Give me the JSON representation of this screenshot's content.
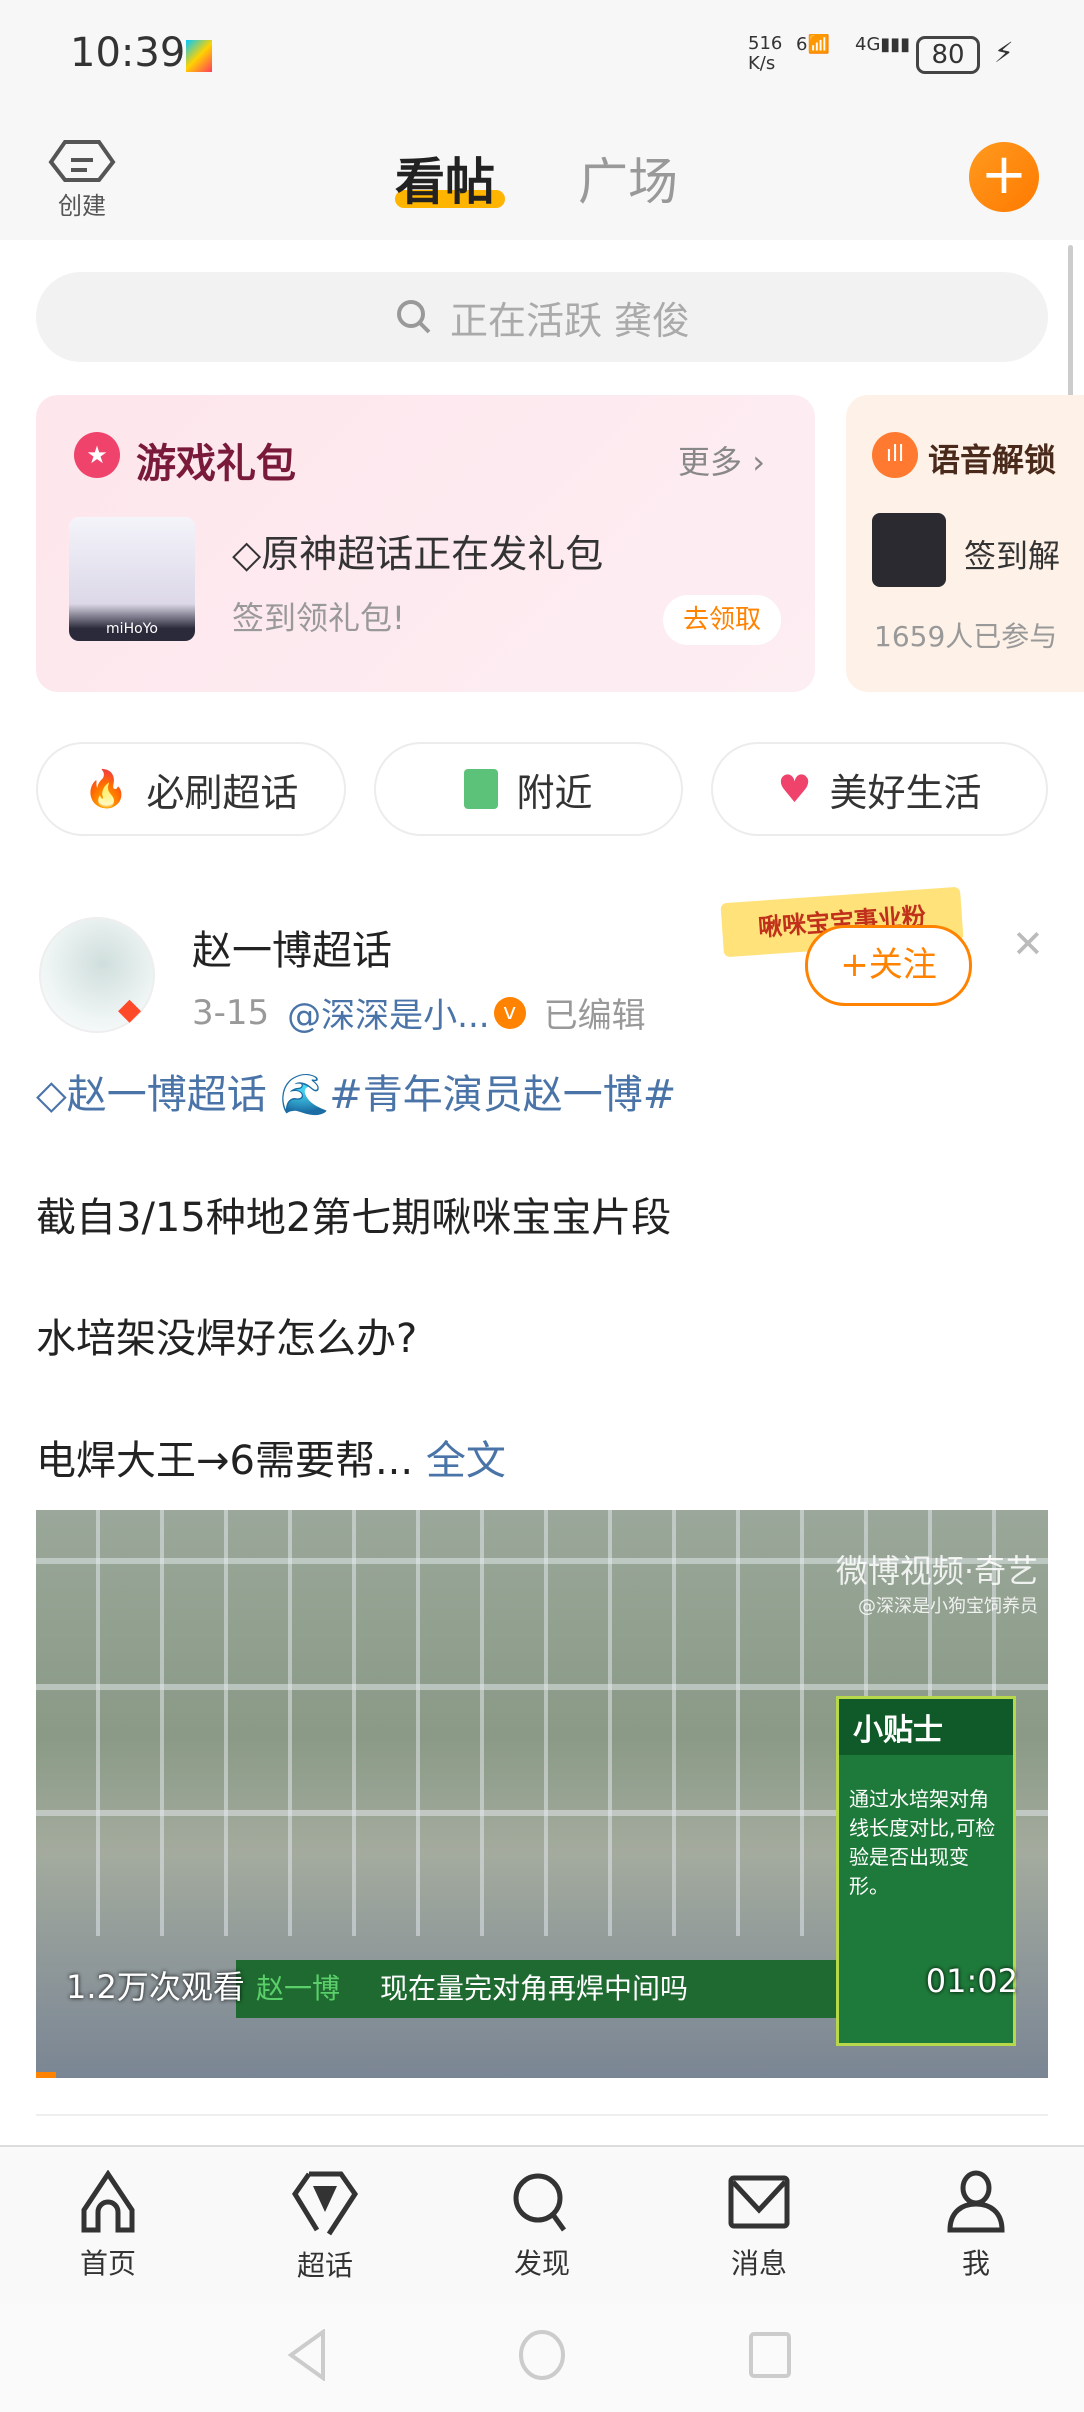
{
  "status_bar": {
    "time": "10:39",
    "net_speed": "516",
    "net_unit": "K/s",
    "wifi": "6",
    "signal": "4G",
    "battery": "80"
  },
  "header": {
    "create_label": "创建",
    "tabs": [
      {
        "label": "看帖",
        "active": true
      },
      {
        "label": "广场",
        "active": false
      }
    ]
  },
  "search": {
    "placeholder": "正在活跃 龚俊"
  },
  "cards": [
    {
      "title": "游戏礼包",
      "more": "更多",
      "item_title": "原神超话正在发礼包",
      "item_sub": "签到领礼包!",
      "action": "去领取",
      "thumb_text": "miHoYo"
    },
    {
      "title": "语音解锁",
      "item_title": "签到解",
      "item_sub": "1659人已参与"
    }
  ],
  "chips": [
    {
      "label": "必刷超话",
      "icon": "fire-icon"
    },
    {
      "label": "附近",
      "icon": "building-icon"
    },
    {
      "label": "美好生活",
      "icon": "heart-icon"
    }
  ],
  "post": {
    "name": "赵一博超话",
    "date": "3-15",
    "author": "@深深是小...",
    "edited": "已编辑",
    "banner": "啾咪宝宝事业粉",
    "follow": "+关注",
    "topic": "赵一博超话",
    "hashtag": "#青年演员赵一博#",
    "lines": [
      "截自3/15种地2第七期啾咪宝宝片段",
      "水培架没焊好怎么办?",
      "电焊大王→6需要帮..."
    ],
    "more": "全文",
    "video": {
      "views": "1.2万次观看",
      "duration": "01:02",
      "watermark": "微博视频·奇艺",
      "watermark_sub": "@深深是小狗宝饲养员",
      "tip_title": "小贴士",
      "tip_text": "通过水培架对角线长度对比,可检验是否出现变形。",
      "subtitle_name": "赵一博",
      "subtitle": "现在量完对角再焊中间吗",
      "progress": 0.02
    }
  },
  "bottom_nav": [
    {
      "label": "首页"
    },
    {
      "label": "超话"
    },
    {
      "label": "发现"
    },
    {
      "label": "消息"
    },
    {
      "label": "我"
    }
  ],
  "colors": {
    "accent": "#ff8200",
    "link": "#4a74a8",
    "tab_underline": "#ffb400"
  }
}
